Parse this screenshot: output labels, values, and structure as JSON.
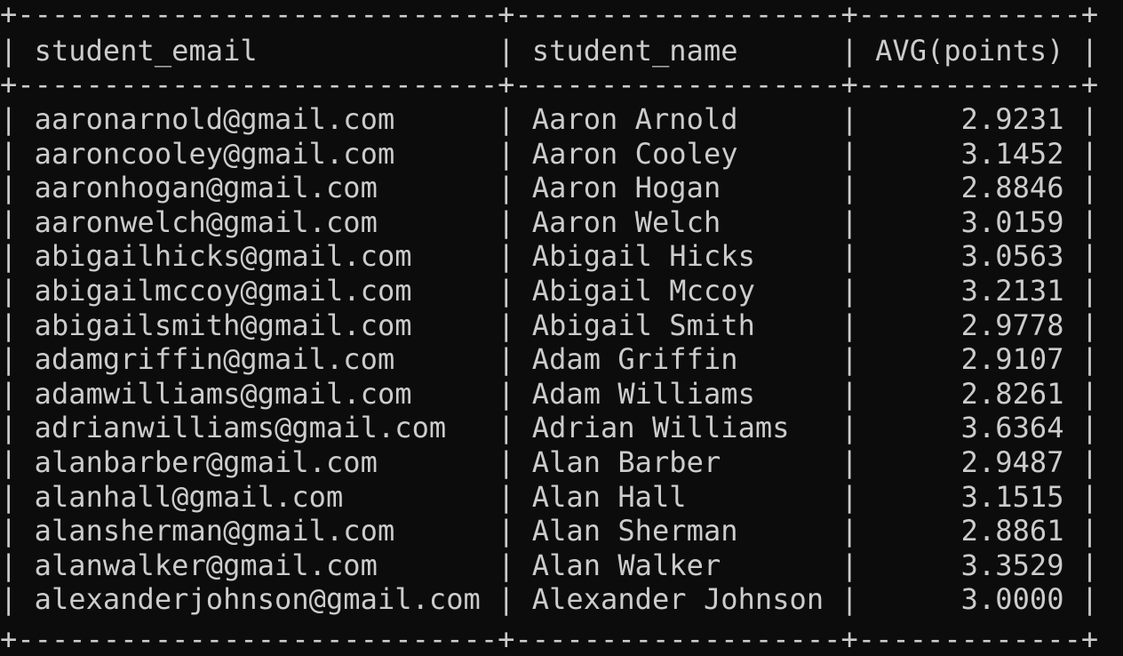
{
  "table": {
    "columns": [
      {
        "name": "student_email",
        "width": 26,
        "align": "left"
      },
      {
        "name": "student_name",
        "width": 17,
        "align": "left"
      },
      {
        "name": "AVG(points)",
        "width": 11,
        "align": "right"
      }
    ],
    "rows": [
      [
        "aaronarnold@gmail.com",
        "Aaron Arnold",
        "2.9231"
      ],
      [
        "aaroncooley@gmail.com",
        "Aaron Cooley",
        "3.1452"
      ],
      [
        "aaronhogan@gmail.com",
        "Aaron Hogan",
        "2.8846"
      ],
      [
        "aaronwelch@gmail.com",
        "Aaron Welch",
        "3.0159"
      ],
      [
        "abigailhicks@gmail.com",
        "Abigail Hicks",
        "3.0563"
      ],
      [
        "abigailmccoy@gmail.com",
        "Abigail Mccoy",
        "3.2131"
      ],
      [
        "abigailsmith@gmail.com",
        "Abigail Smith",
        "2.9778"
      ],
      [
        "adamgriffin@gmail.com",
        "Adam Griffin",
        "2.9107"
      ],
      [
        "adamwilliams@gmail.com",
        "Adam Williams",
        "2.8261"
      ],
      [
        "adrianwilliams@gmail.com",
        "Adrian Williams",
        "3.6364"
      ],
      [
        "alanbarber@gmail.com",
        "Alan Barber",
        "2.9487"
      ],
      [
        "alanhall@gmail.com",
        "Alan Hall",
        "3.1515"
      ],
      [
        "alansherman@gmail.com",
        "Alan Sherman",
        "2.8861"
      ],
      [
        "alanwalker@gmail.com",
        "Alan Walker",
        "3.3529"
      ],
      [
        "alexanderjohnson@gmail.com",
        "Alexander Johnson",
        "3.0000"
      ]
    ]
  },
  "colors": {
    "background": "#0c0c0c",
    "text": "#cccccc"
  }
}
